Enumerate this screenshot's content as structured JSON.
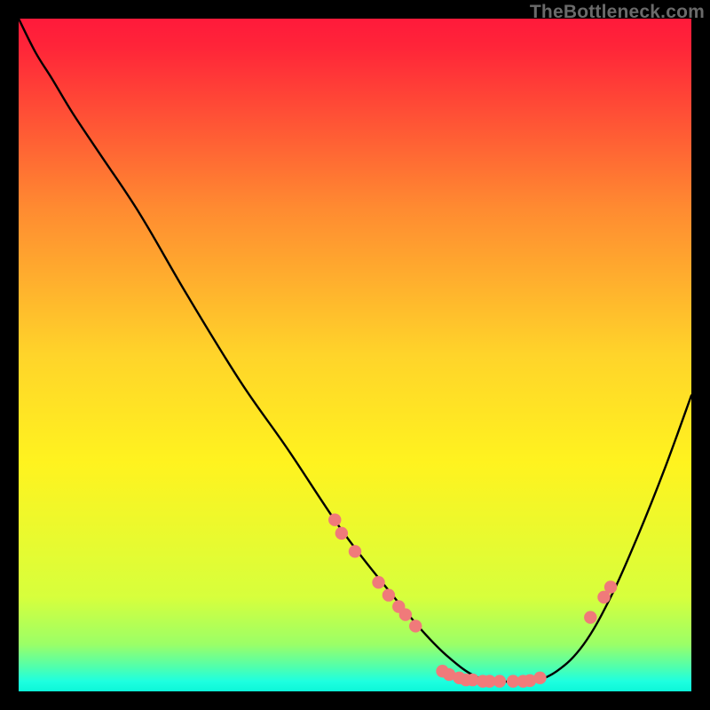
{
  "watermark": "TheBottleneck.com",
  "chart_data": {
    "type": "line",
    "title": "",
    "xlabel": "",
    "ylabel": "",
    "xlim": [
      0,
      100
    ],
    "ylim": [
      0,
      100
    ],
    "gradient_stops": [
      {
        "offset": 0.0,
        "color": "#ff1a3a"
      },
      {
        "offset": 0.04,
        "color": "#ff2439"
      },
      {
        "offset": 0.28,
        "color": "#ff8a31"
      },
      {
        "offset": 0.5,
        "color": "#ffd42a"
      },
      {
        "offset": 0.66,
        "color": "#fff31f"
      },
      {
        "offset": 0.86,
        "color": "#d7ff3c"
      },
      {
        "offset": 0.93,
        "color": "#9bff67"
      },
      {
        "offset": 0.965,
        "color": "#4dffb0"
      },
      {
        "offset": 0.985,
        "color": "#1effe0"
      },
      {
        "offset": 1.0,
        "color": "#0cf7d8"
      }
    ],
    "curve": {
      "x": [
        0,
        2.5,
        5,
        8,
        12,
        18,
        25,
        33,
        40,
        48,
        55,
        60,
        64,
        68,
        72,
        76,
        80,
        84,
        88,
        92,
        96,
        100
      ],
      "y": [
        100,
        95,
        91,
        86,
        80,
        71,
        59,
        46,
        36,
        24,
        15,
        9,
        5,
        2.2,
        1.5,
        1.4,
        3,
        7,
        14,
        23,
        33,
        44
      ]
    },
    "markers": [
      {
        "x": 47.0,
        "y": 25.5
      },
      {
        "x": 48.0,
        "y": 23.5
      },
      {
        "x": 50.0,
        "y": 20.8
      },
      {
        "x": 53.5,
        "y": 16.2
      },
      {
        "x": 55.0,
        "y": 14.3
      },
      {
        "x": 56.5,
        "y": 12.6
      },
      {
        "x": 57.5,
        "y": 11.4
      },
      {
        "x": 59.0,
        "y": 9.7
      },
      {
        "x": 63.0,
        "y": 3.0
      },
      {
        "x": 64.0,
        "y": 2.5
      },
      {
        "x": 65.5,
        "y": 2.0
      },
      {
        "x": 66.5,
        "y": 1.7
      },
      {
        "x": 67.5,
        "y": 1.7
      },
      {
        "x": 69.0,
        "y": 1.5
      },
      {
        "x": 70.0,
        "y": 1.5
      },
      {
        "x": 71.5,
        "y": 1.5
      },
      {
        "x": 73.5,
        "y": 1.5
      },
      {
        "x": 75.0,
        "y": 1.5
      },
      {
        "x": 76.0,
        "y": 1.6
      },
      {
        "x": 77.5,
        "y": 2.0
      },
      {
        "x": 85.0,
        "y": 11.0
      },
      {
        "x": 87.0,
        "y": 14.0
      },
      {
        "x": 88.0,
        "y": 15.5
      }
    ],
    "marker_color": "#f07a7a",
    "curve_stroke": "#000000",
    "curve_width": 2.4
  }
}
